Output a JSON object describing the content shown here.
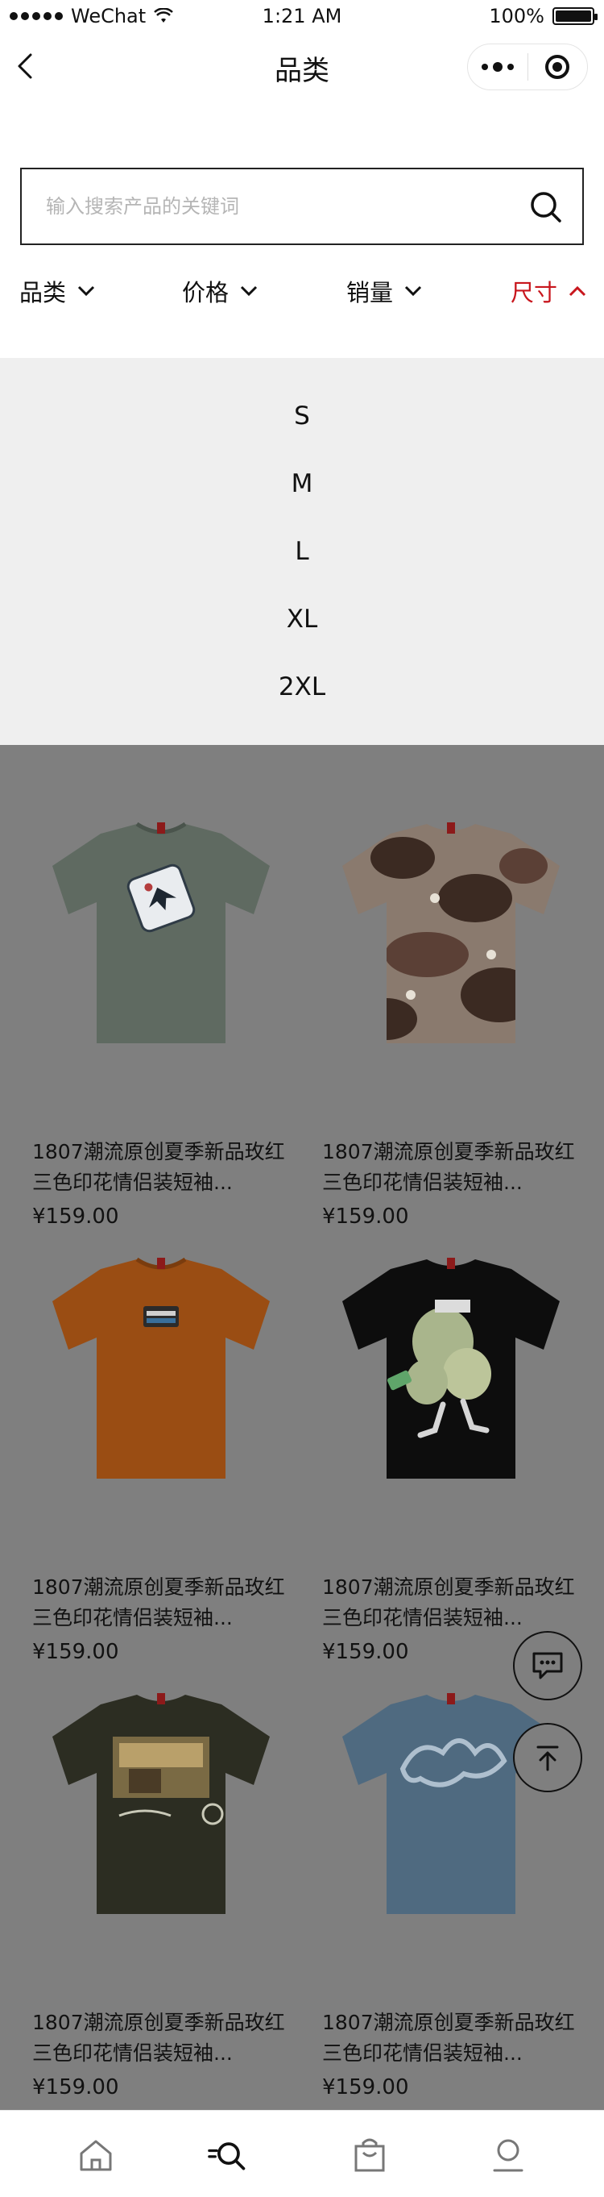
{
  "status_bar": {
    "carrier": "WeChat",
    "time": "1:21 AM",
    "battery": "100%",
    "battery_level": 1.0
  },
  "nav": {
    "title": "品类",
    "back_icon": "chevron-left-icon",
    "more_icon": "more-dots-icon",
    "close_icon": "target-icon"
  },
  "search": {
    "placeholder": "输入搜索产品的关键词",
    "value": "",
    "icon": "search-icon"
  },
  "filters": [
    {
      "label": "品类",
      "icon": "chevron-down-icon",
      "active": false
    },
    {
      "label": "价格",
      "icon": "chevron-down-icon",
      "active": false
    },
    {
      "label": "销量",
      "icon": "chevron-down-icon",
      "active": false
    },
    {
      "label": "尺寸",
      "icon": "chevron-up-icon",
      "active": true
    }
  ],
  "size_options": [
    "S",
    "M",
    "L",
    "XL",
    "2XL"
  ],
  "products": [
    {
      "title": "1807潮流原创夏季新品玫红三色印花情侣装短袖...",
      "price": "¥159.00",
      "shirt_color": "#5f6a61",
      "graphic": "skull-badge"
    },
    {
      "title": "1807潮流原创夏季新品玫红三色印花情侣装短袖...",
      "price": "¥159.00",
      "shirt_color": "#8a7a6e",
      "graphic": "camo-print"
    },
    {
      "title": "1807潮流原创夏季新品玫红三色印花情侣装短袖...",
      "price": "¥159.00",
      "shirt_color": "#9a4d13",
      "graphic": "small-chest-logo"
    },
    {
      "title": "1807潮流原创夏季新品玫红三色印花情侣装短袖...",
      "price": "¥159.00",
      "shirt_color": "#0d0d0d",
      "graphic": "money-bag-character"
    },
    {
      "title": "1807潮流原创夏季新品玫红三色印花情侣装短袖...",
      "price": "¥159.00",
      "shirt_color": "#2c2d22",
      "graphic": "car-interior-photo"
    },
    {
      "title": "1807潮流原创夏季新品玫红三色印花情侣装短袖...",
      "price": "¥159.00",
      "shirt_color": "#4f6a80",
      "graphic": "script-logo"
    }
  ],
  "floating": {
    "chat_icon": "chat-bubble-icon",
    "top_icon": "back-to-top-icon"
  },
  "tabbar": [
    {
      "name": "home",
      "icon": "home-icon"
    },
    {
      "name": "category",
      "icon": "category-search-icon"
    },
    {
      "name": "cart",
      "icon": "shopping-bag-icon"
    },
    {
      "name": "profile",
      "icon": "user-icon"
    }
  ],
  "colors": {
    "accent": "#c8161d",
    "overlay": "#7f7f7f",
    "dropdown_bg": "#efefef"
  }
}
